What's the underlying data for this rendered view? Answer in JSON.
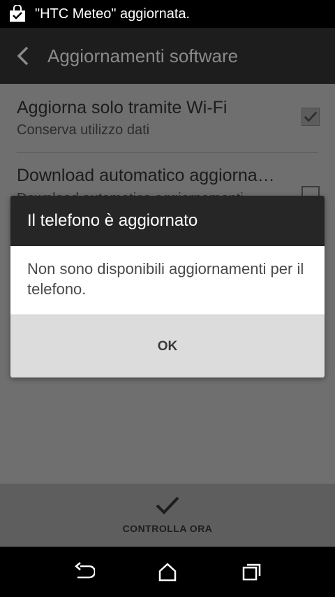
{
  "status_bar": {
    "notification_icon": "shopping-bag-check-icon",
    "notification_text": "\"HTC Meteo\" aggiornata."
  },
  "action_bar": {
    "back_icon": "chevron-left-icon",
    "title": "Aggiornamenti software"
  },
  "settings": {
    "items": [
      {
        "title": "Aggiorna solo tramite Wi-Fi",
        "summary": "Conserva utilizzo dati",
        "checked": true
      },
      {
        "title": "Download automatico aggiornam…",
        "summary": "Download automatico aggiornamenti",
        "checked": false
      }
    ]
  },
  "dialog": {
    "title": "Il telefono è aggiornato",
    "message": "Non sono disponibili aggiornamenti per il telefono.",
    "ok_label": "OK"
  },
  "bottom_action": {
    "icon": "checkmark-icon",
    "label": "CONTROLLA ORA"
  },
  "nav_bar": {
    "back": "back-arrow-icon",
    "home": "home-icon",
    "recents": "recents-icon"
  },
  "colors": {
    "statusbar_bg": "#000000",
    "actionbar_bg": "#1d1d1d",
    "dim_overlay": "#6f6f6f",
    "dialog_header_bg": "#262626",
    "dialog_footer_bg": "#dcdcdc"
  }
}
